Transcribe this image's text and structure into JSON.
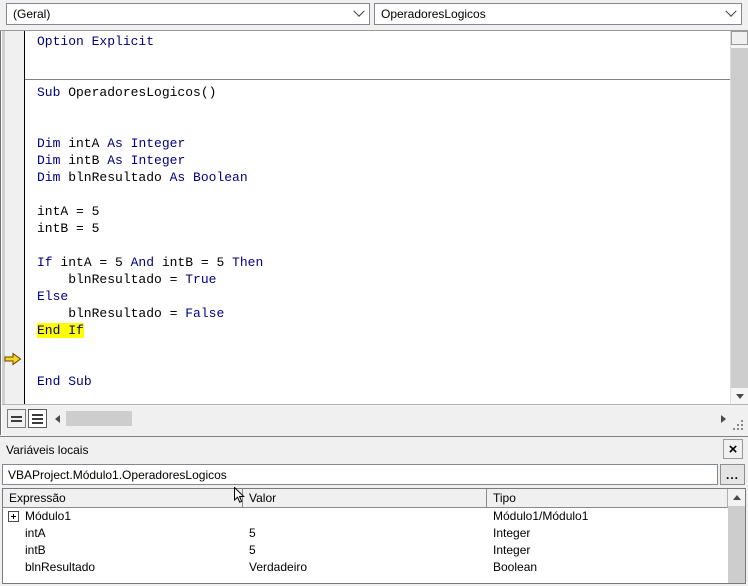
{
  "toolbar": {
    "object_combo": "(Geral)",
    "procedure_combo": "OperadoresLogicos",
    "dropdown_icon": "chevron-down-icon"
  },
  "code": {
    "execution_marker_icon": "yellow-right-arrow-icon",
    "highlighted_line_color": "#ffff00",
    "keyword_color": "#00007f",
    "text_color": "#000000",
    "background": "#ffffff",
    "lines": [
      {
        "indent": 1,
        "tokens": [
          {
            "t": "Option",
            "k": true
          },
          {
            "t": " ",
            "k": false
          },
          {
            "t": "Explicit",
            "k": true
          }
        ]
      },
      {
        "indent": 1,
        "tokens": []
      },
      {
        "indent": 1,
        "tokens": []
      },
      {
        "indent": 1,
        "tokens": [
          {
            "t": "Sub",
            "k": true
          },
          {
            "t": " OperadoresLogicos()",
            "k": false
          }
        ]
      },
      {
        "indent": 1,
        "tokens": []
      },
      {
        "indent": 1,
        "tokens": []
      },
      {
        "indent": 1,
        "tokens": [
          {
            "t": "Dim",
            "k": true
          },
          {
            "t": " intA ",
            "k": false
          },
          {
            "t": "As",
            "k": true
          },
          {
            "t": " ",
            "k": false
          },
          {
            "t": "Integer",
            "k": true
          }
        ]
      },
      {
        "indent": 1,
        "tokens": [
          {
            "t": "Dim",
            "k": true
          },
          {
            "t": " intB ",
            "k": false
          },
          {
            "t": "As",
            "k": true
          },
          {
            "t": " ",
            "k": false
          },
          {
            "t": "Integer",
            "k": true
          }
        ]
      },
      {
        "indent": 1,
        "tokens": [
          {
            "t": "Dim",
            "k": true
          },
          {
            "t": " blnResultado ",
            "k": false
          },
          {
            "t": "As",
            "k": true
          },
          {
            "t": " ",
            "k": false
          },
          {
            "t": "Boolean",
            "k": true
          }
        ]
      },
      {
        "indent": 1,
        "tokens": []
      },
      {
        "indent": 1,
        "tokens": [
          {
            "t": "intA = 5",
            "k": false
          }
        ]
      },
      {
        "indent": 1,
        "tokens": [
          {
            "t": "intB = 5",
            "k": false
          }
        ]
      },
      {
        "indent": 1,
        "tokens": []
      },
      {
        "indent": 1,
        "tokens": [
          {
            "t": "If",
            "k": true
          },
          {
            "t": " intA = 5 ",
            "k": false
          },
          {
            "t": "And",
            "k": true
          },
          {
            "t": " intB = 5 ",
            "k": false
          },
          {
            "t": "Then",
            "k": true
          }
        ]
      },
      {
        "indent": 1,
        "tokens": [
          {
            "t": "    blnResultado = ",
            "k": false
          },
          {
            "t": "True",
            "k": true
          }
        ]
      },
      {
        "indent": 1,
        "tokens": [
          {
            "t": "Else",
            "k": true
          }
        ]
      },
      {
        "indent": 1,
        "tokens": [
          {
            "t": "    blnResultado = ",
            "k": false
          },
          {
            "t": "False",
            "k": true
          }
        ]
      },
      {
        "indent": 1,
        "highlight": true,
        "tokens": [
          {
            "t": "End If",
            "k": true
          }
        ]
      },
      {
        "indent": 1,
        "tokens": []
      },
      {
        "indent": 1,
        "tokens": []
      },
      {
        "indent": 1,
        "tokens": [
          {
            "t": "End",
            "k": true
          },
          {
            "t": " ",
            "k": false
          },
          {
            "t": "Sub",
            "k": true
          }
        ]
      }
    ],
    "view_buttons": {
      "procedure_view": "procedure-view-icon",
      "full_module_view": "full-module-view-icon"
    }
  },
  "locals": {
    "title": "Variáveis locais",
    "close_label": "×",
    "context_path": "VBAProject.Módulo1.OperadoresLogicos",
    "ellipsis_label": "...",
    "columns": [
      "Expressão",
      "Valor",
      "Tipo"
    ],
    "rows": [
      {
        "expression": "Módulo1",
        "value": "",
        "type": "Módulo1/Módulo1",
        "expandable": true
      },
      {
        "expression": "intA",
        "value": "5",
        "type": "Integer",
        "expandable": false
      },
      {
        "expression": "intB",
        "value": "5",
        "type": "Integer",
        "expandable": false
      },
      {
        "expression": "blnResultado",
        "value": "Verdadeiro",
        "type": "Boolean",
        "expandable": false
      }
    ]
  }
}
